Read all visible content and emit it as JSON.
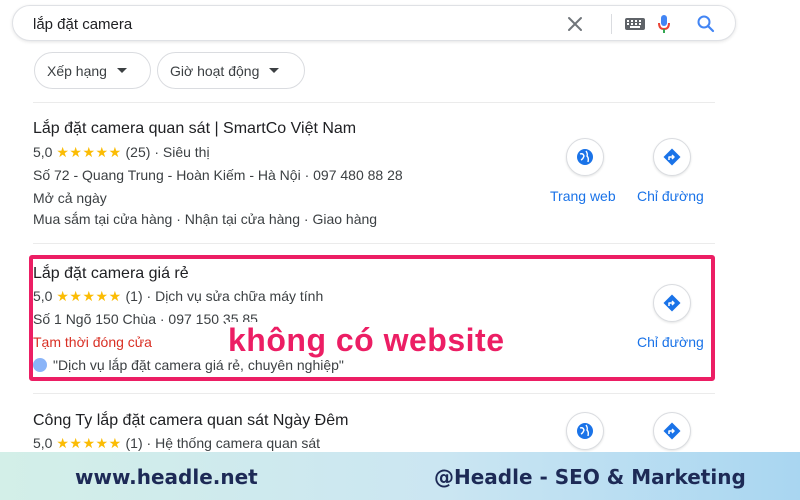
{
  "search": {
    "query": "lắp đặt camera"
  },
  "filters": [
    {
      "label": "Xếp hạng"
    },
    {
      "label": "Giờ hoạt động"
    }
  ],
  "results": [
    {
      "title": "Lắp đặt camera quan sát | SmartCo Việt Nam",
      "rating": "5,0",
      "stars": "★★★★★",
      "reviews": "(25)",
      "category": "· Siêu thị",
      "address_phone": "Số 72 - Quang Trung - Hoàn Kiếm - Hà Nội · 097 480 88 28",
      "hours": "Mở cả ngày",
      "services": "Mua sắm tại cửa hàng · Nhận tại cửa hàng · Giao hàng",
      "website_label": "Trang web",
      "directions_label": "Chỉ đường"
    },
    {
      "title": "Lắp đặt camera giá rẻ",
      "rating": "5,0",
      "stars": "★★★★★",
      "reviews": "(1)",
      "category": "· Dịch vụ sửa chữa máy tính",
      "address_phone": "Số 1 Ngõ 150 Chùa · 097 150 35 85",
      "status": "Tạm thời đóng cửa",
      "review_snippet": "\"Dịch vụ lắp đặt camera giá rẻ, chuyên nghiệp\"",
      "directions_label": "Chỉ đường"
    },
    {
      "title": "Công Ty lắp đặt camera quan sát Ngày Đêm",
      "rating": "5,0",
      "stars": "★★★★★",
      "reviews": "(1)",
      "category": "· Hệ thống camera quan sát"
    }
  ],
  "annotation": {
    "text": "không có website",
    "color": "#ec1e64"
  },
  "footer": {
    "left": "www.headle.net",
    "right": "@Headle - SEO & Marketing"
  },
  "colors": {
    "link": "#1a73e8",
    "star": "#fbbc04",
    "closed": "#d93025"
  },
  "icons": [
    "close-icon",
    "keyboard-icon",
    "mic-icon",
    "search-icon",
    "caret-down-icon",
    "globe-icon",
    "directions-icon",
    "avatar-icon"
  ]
}
